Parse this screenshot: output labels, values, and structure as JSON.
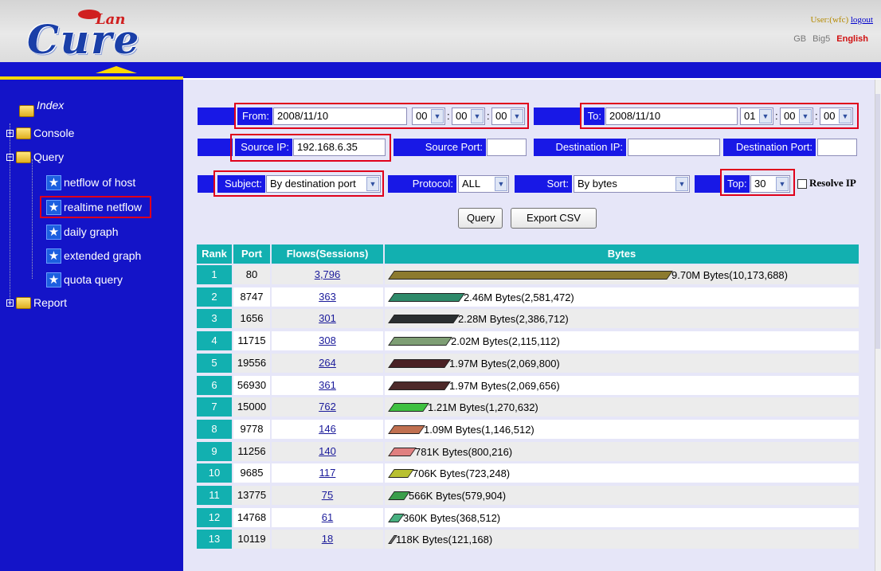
{
  "header": {
    "logo_text": "Cure",
    "logo_lan": "Lan",
    "user_label": "User:(wfc)",
    "logout_label": "logout",
    "lang": [
      "GB",
      "Big5",
      "English"
    ]
  },
  "sidebar": {
    "index": "Index",
    "console": "Console",
    "query": "Query",
    "items": [
      "netflow of host",
      "realtime netflow",
      "daily graph",
      "extended graph",
      "quota query"
    ],
    "report": "Report"
  },
  "form": {
    "from_label": "From:",
    "from_date": "2008/11/10",
    "from_h": "00",
    "from_m": "00",
    "from_s": "00",
    "to_label": "To:",
    "to_date": "2008/11/10",
    "to_h": "01",
    "to_m": "00",
    "to_s": "00",
    "source_ip_label": "Source IP:",
    "source_ip": "192.168.6.35",
    "source_port_label": "Source Port:",
    "dest_ip_label": "Destination IP:",
    "dest_port_label": "Destination Port:",
    "subject_label": "Subject:",
    "subject_value": "By destination port",
    "protocol_label": "Protocol:",
    "protocol_value": "ALL",
    "sort_label": "Sort:",
    "sort_value": "By bytes",
    "top_label": "Top:",
    "top_value": "30",
    "resolve_label": "Resolve IP",
    "query_button": "Query",
    "export_button": "Export CSV"
  },
  "table": {
    "headers": [
      "Rank",
      "Port",
      "Flows(Sessions)",
      "Bytes"
    ],
    "rows": [
      {
        "rank": "1",
        "port": "80",
        "flows": "3,796",
        "bytes_label": "9.70M Bytes(10,173,688)",
        "bytes": 10173688,
        "color": "#8c7a2e"
      },
      {
        "rank": "2",
        "port": "8747",
        "flows": "363",
        "bytes_label": "2.46M Bytes(2,581,472)",
        "bytes": 2581472,
        "color": "#2e8a6a"
      },
      {
        "rank": "3",
        "port": "1656",
        "flows": "301",
        "bytes_label": "2.28M Bytes(2,386,712)",
        "bytes": 2386712,
        "color": "#2a2e30"
      },
      {
        "rank": "4",
        "port": "11715",
        "flows": "308",
        "bytes_label": "2.02M Bytes(2,115,112)",
        "bytes": 2115112,
        "color": "#7e9e74"
      },
      {
        "rank": "5",
        "port": "19556",
        "flows": "264",
        "bytes_label": "1.97M Bytes(2,069,800)",
        "bytes": 2069800,
        "color": "#4a2024"
      },
      {
        "rank": "6",
        "port": "56930",
        "flows": "361",
        "bytes_label": "1.97M Bytes(2,069,656)",
        "bytes": 2069656,
        "color": "#4e2a2a"
      },
      {
        "rank": "7",
        "port": "15000",
        "flows": "762",
        "bytes_label": "1.21M Bytes(1,270,632)",
        "bytes": 1270632,
        "color": "#3ec040"
      },
      {
        "rank": "8",
        "port": "9778",
        "flows": "146",
        "bytes_label": "1.09M Bytes(1,146,512)",
        "bytes": 1146512,
        "color": "#c07050"
      },
      {
        "rank": "9",
        "port": "11256",
        "flows": "140",
        "bytes_label": "781K Bytes(800,216)",
        "bytes": 800216,
        "color": "#e08080"
      },
      {
        "rank": "10",
        "port": "9685",
        "flows": "117",
        "bytes_label": "706K Bytes(723,248)",
        "bytes": 723248,
        "color": "#b8c030"
      },
      {
        "rank": "11",
        "port": "13775",
        "flows": "75",
        "bytes_label": "566K Bytes(579,904)",
        "bytes": 579904,
        "color": "#3a9e4a"
      },
      {
        "rank": "12",
        "port": "14768",
        "flows": "61",
        "bytes_label": "360K Bytes(368,512)",
        "bytes": 368512,
        "color": "#48b080"
      },
      {
        "rank": "13",
        "port": "10119",
        "flows": "18",
        "bytes_label": "118K Bytes(121,168)",
        "bytes": 121168,
        "color": "#6a6a6a"
      }
    ]
  }
}
